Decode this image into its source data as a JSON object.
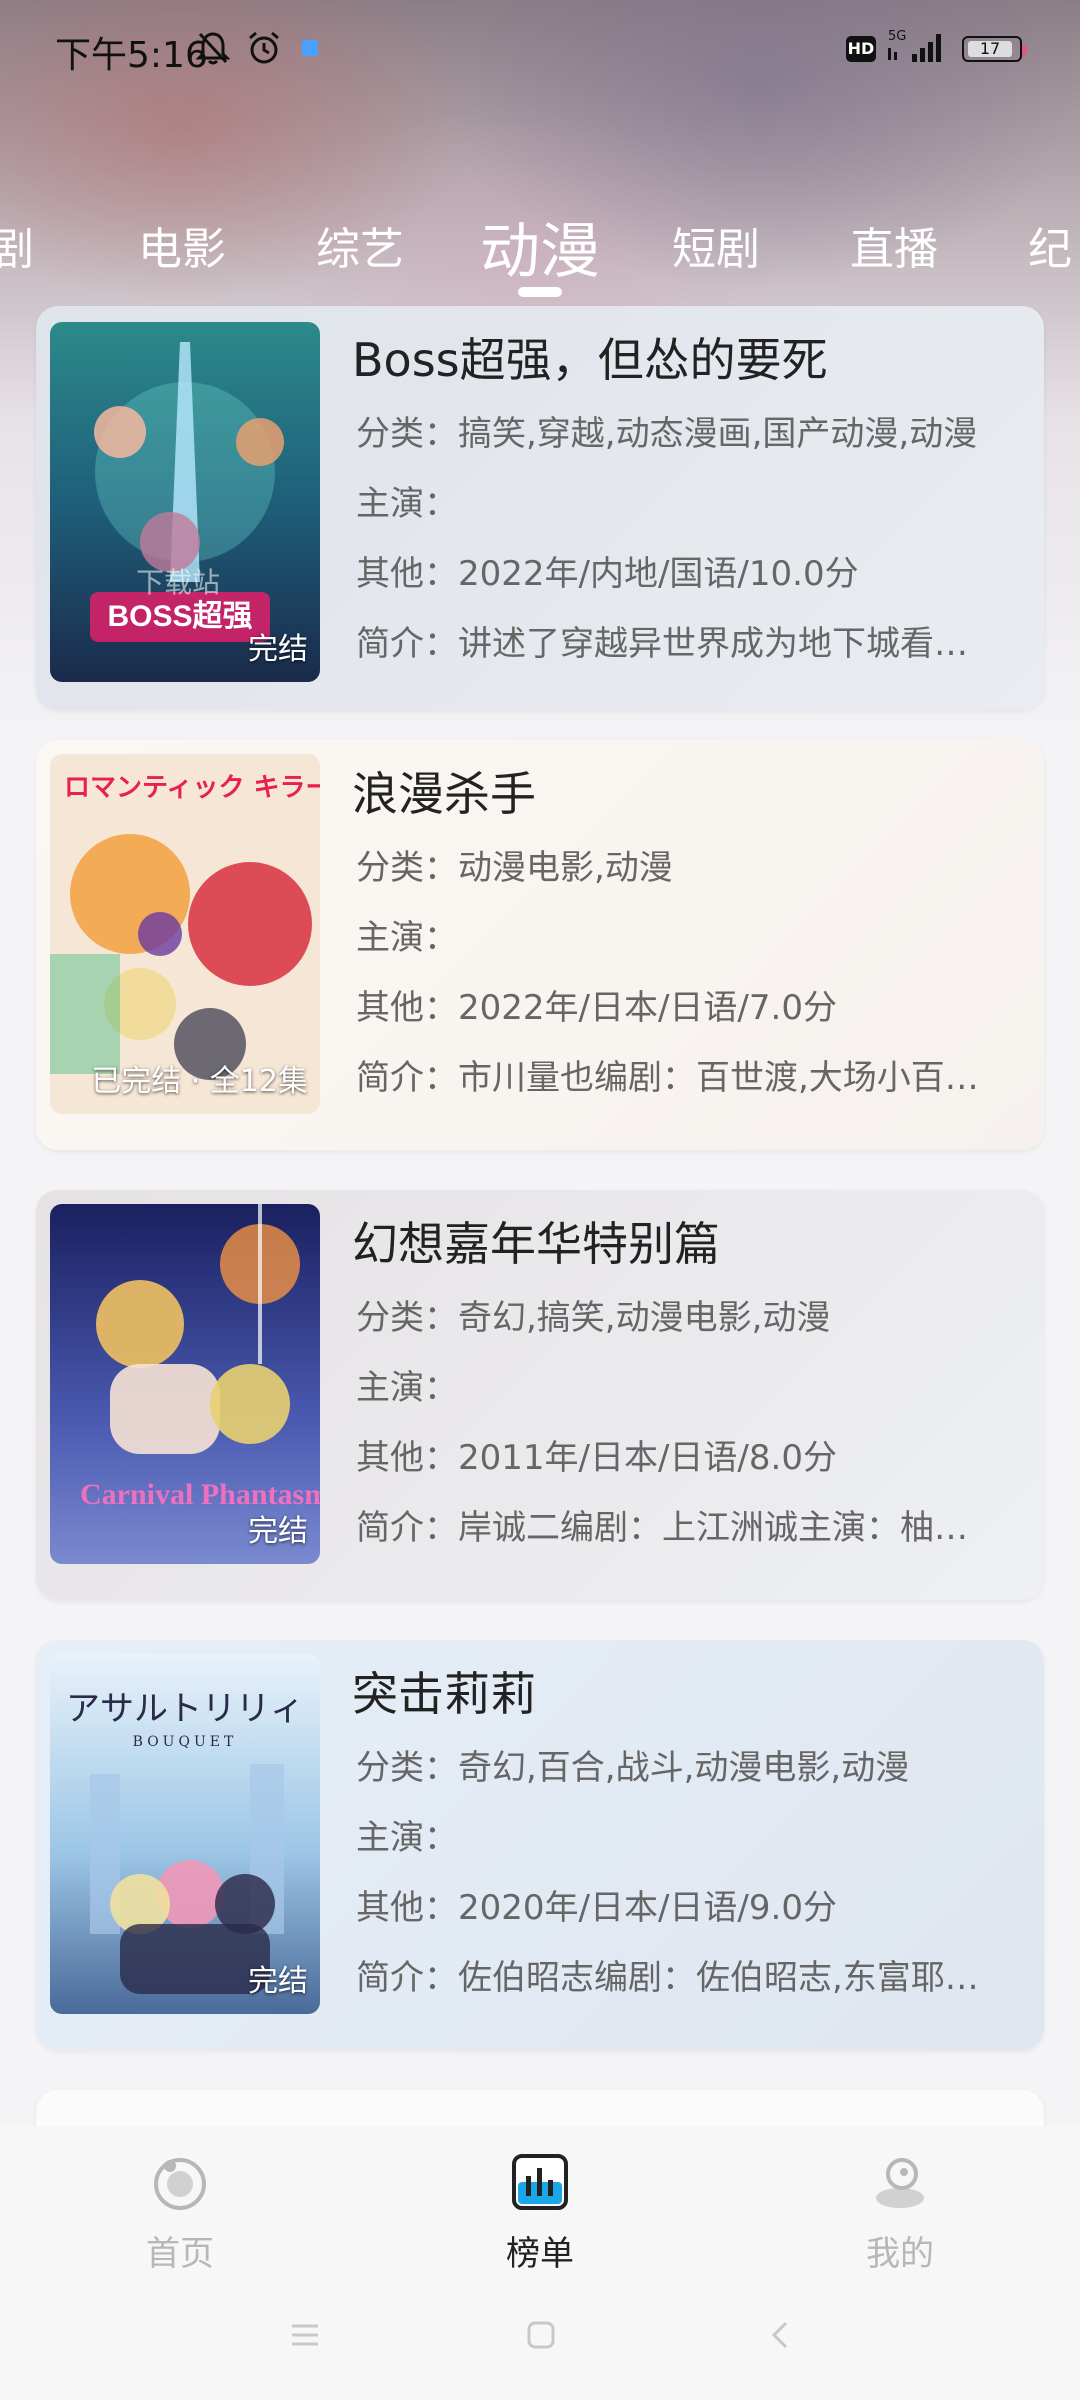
{
  "status_bar": {
    "time": "下午5:16",
    "network": "5G",
    "hd": "HD",
    "battery": "17"
  },
  "tabs": [
    {
      "label": "剧"
    },
    {
      "label": "电影"
    },
    {
      "label": "综艺"
    },
    {
      "label": "动漫"
    },
    {
      "label": "短剧"
    },
    {
      "label": "直播"
    },
    {
      "label": "纪"
    }
  ],
  "active_tab": "动漫",
  "labels": {
    "category": "分类：",
    "cast": "主演：",
    "other": "其他：",
    "intro": "简介："
  },
  "items": [
    {
      "title": "Boss超强，但怂的要死",
      "category": "搞笑,穿越,动态漫画,国产动漫,动漫",
      "cast": "",
      "other": "2022年/内地/国语/10.0分",
      "intro": "讲述了穿越异世界成为地下城看…",
      "badge": "完结",
      "poster_text": "BOSS超强",
      "watermark": "下载站"
    },
    {
      "title": "浪漫杀手",
      "category": "动漫电影,动漫",
      "cast": "",
      "other": "2022年/日本/日语/7.0分",
      "intro": "市川量也编剧：百世渡,大场小百…",
      "badge": "已完结 · 全12集",
      "poster_text": "ロマンティック キラー"
    },
    {
      "title": "幻想嘉年华特别篇",
      "category": "奇幻,搞笑,动漫电影,动漫",
      "cast": "",
      "other": "2011年/日本/日语/8.0分",
      "intro": "岸诚二编剧：上江洲诚主演：柚…",
      "badge": "完结",
      "poster_text": "Carnival Phantasm"
    },
    {
      "title": "突击莉莉",
      "category": "奇幻,百合,战斗,动漫电影,动漫",
      "cast": "",
      "other": "2020年/日本/日语/9.0分",
      "intro": "佐伯昭志编剧：佐伯昭志,东富耶…",
      "badge": "完结",
      "poster_text": "アサルトリリィ",
      "poster_subtext": "BOUQUET"
    }
  ],
  "bottom_nav": [
    {
      "label": "首页",
      "icon": "home-icon"
    },
    {
      "label": "榜单",
      "icon": "chart-icon"
    },
    {
      "label": "我的",
      "icon": "profile-icon"
    }
  ],
  "colors": {
    "active_nav": "#222222",
    "inactive_nav": "#b7b7b7",
    "chart_icon_fill": "#1aa7e8"
  }
}
